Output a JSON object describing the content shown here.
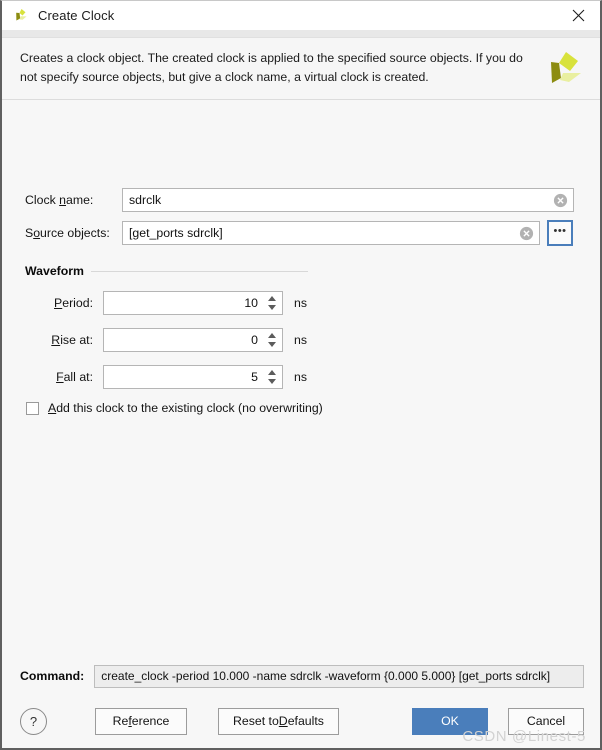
{
  "window": {
    "title": "Create Clock",
    "icon": "vivado-logo-icon",
    "close_label": "✕"
  },
  "header": {
    "description": "Creates a clock object. The created clock is applied to the specified source objects. If you do not specify source objects, but give a clock name, a virtual clock is created.",
    "logo": "xilinx-logo-icon"
  },
  "fields": {
    "clock_name": {
      "label_before": "Clock ",
      "label_mnemonic": "n",
      "label_after": "ame:",
      "value": "sdrclk",
      "placeholder": ""
    },
    "source_objects": {
      "label_before": "S",
      "label_mnemonic": "o",
      "label_after": "urce objects:",
      "value": "[get_ports sdrclk]",
      "placeholder": "",
      "browse_label": "•••"
    }
  },
  "waveform": {
    "title": "Waveform",
    "rows": [
      {
        "label_before": "",
        "label_mnemonic": "P",
        "label_after": "eriod:",
        "value": "10",
        "unit": "ns"
      },
      {
        "label_before": "",
        "label_mnemonic": "R",
        "label_after": "ise at:",
        "value": "0",
        "unit": "ns"
      },
      {
        "label_before": "",
        "label_mnemonic": "F",
        "label_after": "all at:",
        "value": "5",
        "unit": "ns"
      }
    ]
  },
  "checkbox": {
    "checked": false,
    "label_before": "",
    "label_mnemonic": "A",
    "label_after": "dd this clock to the existing clock (no overwriting)"
  },
  "command": {
    "label": "Command:",
    "value": "create_clock -period 10.000 -name sdrclk -waveform {0.000 5.000} [get_ports sdrclk]"
  },
  "footer": {
    "help_label": "?",
    "reference": {
      "before": "Re",
      "mnemonic": "f",
      "after": "erence"
    },
    "reset_defaults": {
      "before": "Reset to ",
      "mnemonic": "D",
      "after": "efaults"
    },
    "ok_label": "OK",
    "cancel_label": "Cancel"
  },
  "watermark": "CSDN @Linest-5",
  "colors": {
    "accent": "#4a7ebb",
    "dialog_bg": "#f7f7f7",
    "titlebar_bg": "#ffffff",
    "border": "#606060",
    "logo_light": "#d8e23c",
    "logo_dark": "#8c8c11"
  }
}
